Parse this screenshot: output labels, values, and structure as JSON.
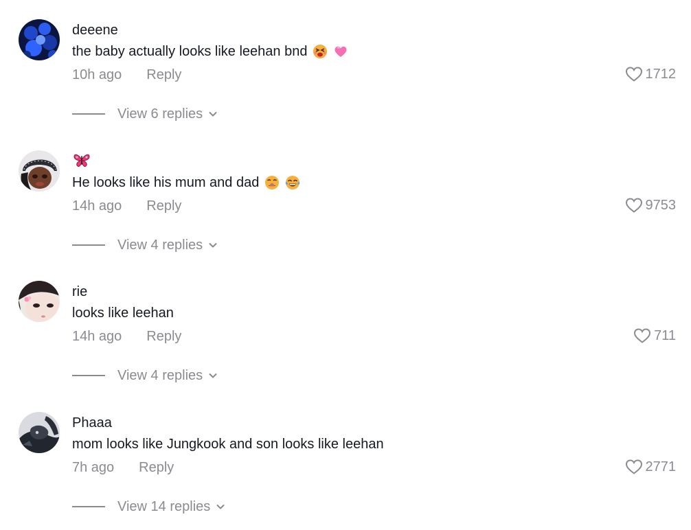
{
  "comments": [
    {
      "username": "deeene",
      "text": "the baby actually looks like leehan bnd",
      "text_emojis": [
        "squinting-face-emoji",
        "pink-heart-emoji"
      ],
      "time": "10h ago",
      "reply_label": "Reply",
      "likes": "1712",
      "view_replies": "View 6 replies",
      "avatar": "blue-jellyfish-avatar"
    },
    {
      "username": "",
      "username_emoji": "butterfly-emoji",
      "text": "He looks like his mum and dad",
      "text_emojis": [
        "weary-face-emoji",
        "tears-of-joy-emoji"
      ],
      "time": "14h ago",
      "reply_label": "Reply",
      "likes": "9753",
      "view_replies": "View 4 replies",
      "avatar": "doll-bandana-avatar"
    },
    {
      "username": "rie",
      "text": "looks like leehan",
      "text_emojis": [],
      "time": "14h ago",
      "reply_label": "Reply",
      "likes": "711",
      "view_replies": "View 4 replies",
      "avatar": "girl-hairclip-avatar"
    },
    {
      "username": "Phaaa",
      "text": "mom looks like Jungkook and son looks like leehan",
      "text_emojis": [],
      "time": "7h ago",
      "reply_label": "Reply",
      "likes": "2771",
      "view_replies": "View 14 replies",
      "avatar": "dark-photo-avatar"
    }
  ],
  "colors": {
    "text_primary": "#161823",
    "text_secondary": "#8a8b91",
    "background": "#ffffff"
  }
}
